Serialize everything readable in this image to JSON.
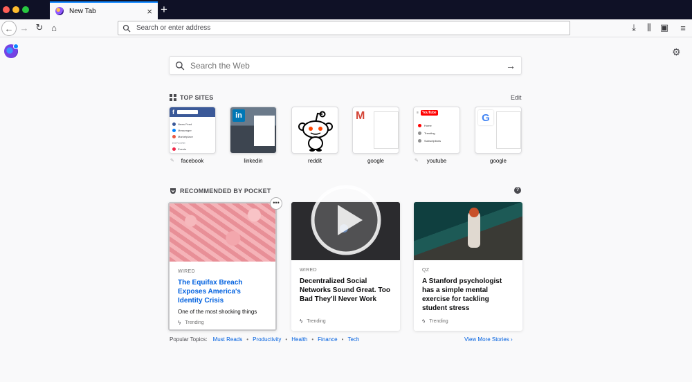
{
  "window": {
    "tab_title": "New Tab",
    "tab_close": "×",
    "new_tab": "+"
  },
  "navbar": {
    "back": "←",
    "forward": "→",
    "reload": "↻",
    "home": "⌂",
    "url_placeholder": "Search or enter address",
    "download": "⤓",
    "library": "⫼",
    "sidebar": "▣",
    "menu": "≡"
  },
  "newtab": {
    "search_placeholder": "Search the Web",
    "search_arrow": "→",
    "settings_icon": "⚙"
  },
  "top_sites": {
    "heading": "TOP SITES",
    "edit": "Edit",
    "sites": [
      {
        "label": "facebook",
        "pinned": true
      },
      {
        "label": "linkedin",
        "pinned": false
      },
      {
        "label": "reddit",
        "pinned": false
      },
      {
        "label": "google",
        "pinned": false
      },
      {
        "label": "youtube",
        "pinned": true
      },
      {
        "label": "google",
        "pinned": false
      }
    ],
    "facebook_tile": {
      "brand": "f",
      "rows": [
        "News Feed",
        "Messenger",
        "Marketplace"
      ],
      "explore": "EXPLORE",
      "events": "Events"
    },
    "linkedin_tile": {
      "brand": "in"
    },
    "gmail_tile": {
      "brand": "M"
    },
    "youtube_tile": {
      "brand": "YouTube",
      "rows": [
        "Home",
        "Trending",
        "Subscriptions"
      ]
    },
    "google_tile": {
      "brand": "G"
    }
  },
  "pocket": {
    "heading": "RECOMMENDED BY POCKET",
    "help": "?",
    "card_menu": "•••",
    "cards": [
      {
        "source": "WIRED",
        "title": "The Equifax Breach Exposes America's Identity Crisis",
        "excerpt": "One of the most shocking things",
        "context": "Trending"
      },
      {
        "source": "WIRED",
        "title": "Decentralized Social Networks Sound Great. Too Bad They'll Never Work",
        "excerpt": "",
        "context": "Trending"
      },
      {
        "source": "QZ",
        "title": "A Stanford psychologist has a simple mental exercise for tackling student stress",
        "excerpt": "",
        "context": "Trending"
      }
    ],
    "popular_label": "Popular Topics:",
    "topics": [
      "Must Reads",
      "Productivity",
      "Health",
      "Finance",
      "Tech"
    ],
    "view_more": "View More Stories"
  },
  "colors": {
    "tabstrip": "#0f1126",
    "accent": "#0a84ff",
    "link": "#0060df"
  }
}
